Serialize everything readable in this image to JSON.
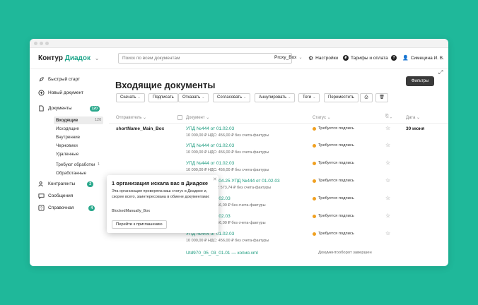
{
  "logo": {
    "brand": "Контур",
    "product": "Диадок"
  },
  "search": {
    "placeholder": "Поиск по всем документам"
  },
  "topbar": {
    "box": "Proxy_Box",
    "settings": "Настройки",
    "tariffs": "Тарифы и оплата",
    "help": "?",
    "user": "Симецина И. В."
  },
  "sidebar": {
    "quick_start": "Быстрый старт",
    "new_document": "Новый документ",
    "documents": "Документы",
    "documents_badge": "120",
    "incoming": "Входящие",
    "incoming_count": "120",
    "outgoing": "Исходящие",
    "internal": "Внутренние",
    "drafts": "Черновики",
    "deleted": "Удаленные",
    "need_processing": "Требуют обработки",
    "need_processing_count": "1",
    "processed": "Обработанные",
    "counterparties": "Контрагенты",
    "counterparties_badge": "2",
    "messages": "Сообщения",
    "help": "Справочная",
    "help_badge": "4"
  },
  "main": {
    "title": "Входящие документы",
    "filters": "Фильтры",
    "toolbar": {
      "download": "Скачать",
      "sign": "Подписать",
      "refuse": "Отказать",
      "approve": "Согласовать",
      "cancel": "Аннулировать",
      "tags": "Теги",
      "move": "Переместить"
    },
    "columns": {
      "sender": "Отправитель",
      "document": "Документ",
      "status": "Статус",
      "date": "Дата"
    }
  },
  "rows": [
    {
      "sender": "shortName_Main_Box",
      "title": "УПД №444 от 01.02.03",
      "sub": "10 000,00 ₽ НДС: 456,00 ₽ без счета-фактуры",
      "status": "Требуется подпись",
      "date": "30 июня"
    },
    {
      "title": "УПД №444 от 01.02.03",
      "sub": "10 000,00 ₽ НДС: 456,00 ₽ без счета-фактуры",
      "status": "Требуется подпись"
    },
    {
      "title": "УПД №444 от 01.02.03",
      "sub": "10 000,00 ₽ НДС: 456,00 ₽ без счета-фактуры",
      "status": "Требуется подпись"
    },
    {
      "title": "от 21.04.25 УПД №444 от 01.02.03",
      "sub": "12 573,74 ₽ без счета-фактуры",
      "status": "Требуется подпись"
    },
    {
      "title": "1.02.03",
      "sub": "456,00 ₽ без счета-фактуры",
      "status": "Требуется подпись"
    },
    {
      "title": "1.02.03",
      "sub": "456,00 ₽ без счета-фактуры",
      "status": "Требуется подпись"
    },
    {
      "title": "УПД №444 от 01.02.03",
      "sub": "10 000,00 ₽ НДС: 456,00 ₽ без счета-фактуры",
      "status": "Требуется подпись"
    },
    {
      "title": "Utd970_05_03_01.01 — копия.xml",
      "sub": "",
      "status": "Документооборот завершен"
    }
  ],
  "popup": {
    "title": "1 организация искала вас в Диадоке",
    "text": "Эта организация проверяла ваш статус в Диадоке и, скорее всего, заинтересована в обмене документами:",
    "box": "BlockedManually_Box",
    "button": "Перейти к приглашению"
  }
}
